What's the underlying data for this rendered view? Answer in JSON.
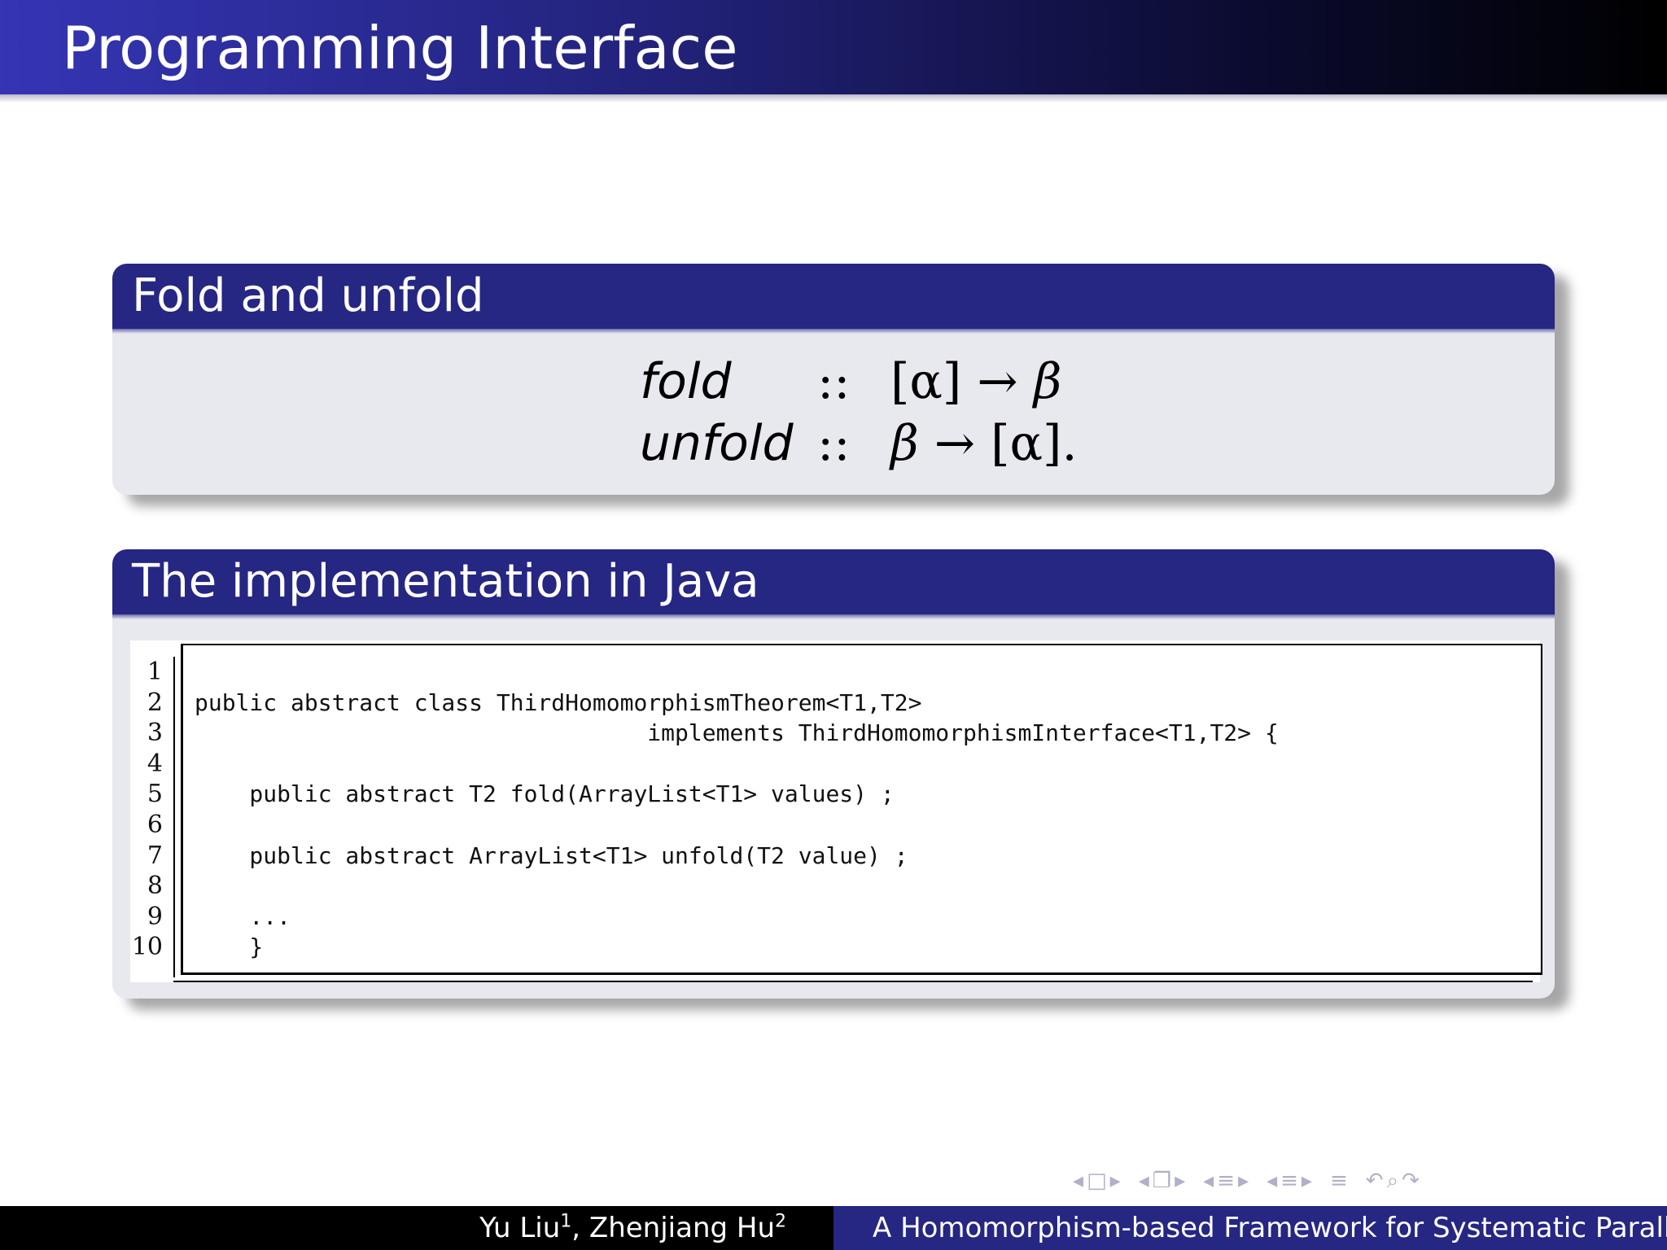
{
  "slide": {
    "title": "Programming Interface"
  },
  "fold_block": {
    "title": "Fold and unfold",
    "equations": [
      {
        "lhs": "fold",
        "sep": "::",
        "rhs_a": "[α]",
        "arrow": "→",
        "rhs_b": "β",
        "rhs_end": ""
      },
      {
        "lhs": "unfold",
        "sep": "::",
        "rhs_a": "β",
        "arrow": "→",
        "rhs_b": "[α]",
        "rhs_end": "."
      }
    ]
  },
  "java_block": {
    "title": "The implementation in Java",
    "line_numbers": [
      "1",
      "2",
      "3",
      "4",
      "5",
      "6",
      "7",
      "8",
      "9",
      "10"
    ],
    "code_lines": [
      "",
      "public abstract class ThirdHomomorphismTheorem<T1,T2>",
      "                                 implements ThirdHomomorphismInterface<T1,T2> {",
      "",
      "    public abstract T2 fold(ArrayList<T1> values) ;",
      "",
      "    public abstract ArrayList<T1> unfold(T2 value) ;",
      "",
      "    ...",
      "    }"
    ]
  },
  "footer": {
    "author1": "Yu Liu",
    "author1_sup": "1",
    "author_sep": ", ",
    "author2": "Zhenjiang Hu",
    "author2_sup": "2",
    "talk_title": "A Homomorphism-based Framework for Systematic Parallel Programming"
  },
  "nav_icons": [
    "nav-left-icon",
    "frame-icon",
    "nav-right-icon",
    "nav-left-icon",
    "subsection-icon",
    "nav-right-icon",
    "nav-left-icon",
    "section-icon",
    "nav-right-icon",
    "nav-left-icon",
    "section-icon",
    "nav-right-icon",
    "align-icon",
    "undo-icon",
    "search-icon",
    "redo-icon"
  ]
}
